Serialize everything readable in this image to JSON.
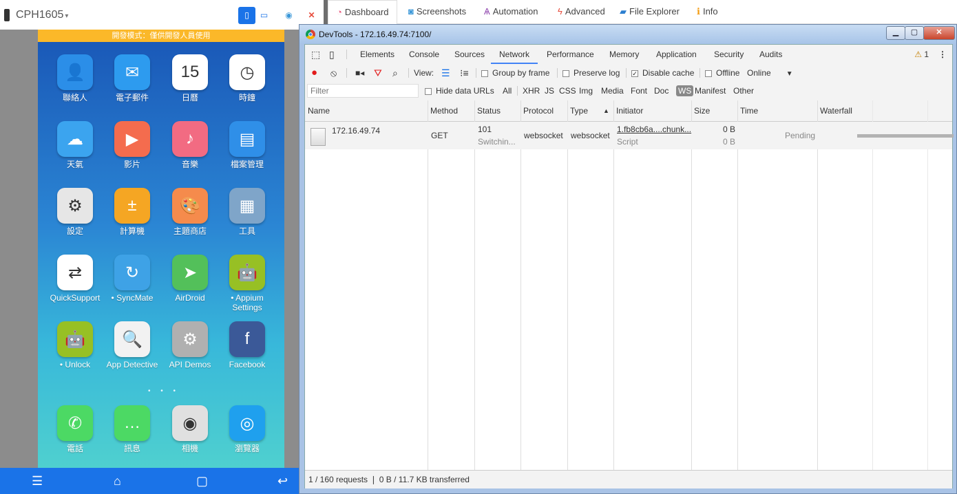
{
  "device": {
    "name": "CPH1605",
    "banner": "開發模式：僅供開發人員使用",
    "apps": [
      {
        "label": "聯絡人",
        "icon": "contacts-icon",
        "color": "#2b8ee8",
        "glyph": "👤"
      },
      {
        "label": "電子郵件",
        "icon": "mail-icon",
        "color": "#2d9bef",
        "glyph": "✉"
      },
      {
        "label": "日曆",
        "icon": "calendar-icon",
        "color": "#ffffff",
        "glyph": "15"
      },
      {
        "label": "時鐘",
        "icon": "clock-icon",
        "color": "#ffffff",
        "glyph": "◷"
      },
      {
        "label": "天氣",
        "icon": "weather-icon",
        "color": "#3ba4ef",
        "glyph": "☁"
      },
      {
        "label": "影片",
        "icon": "video-icon",
        "color": "#f46c4e",
        "glyph": "▶"
      },
      {
        "label": "音樂",
        "icon": "music-icon",
        "color": "#f26b82",
        "glyph": "♪"
      },
      {
        "label": "檔案管理",
        "icon": "file-manager-icon",
        "color": "#2f8fe8",
        "glyph": "▤"
      },
      {
        "label": "設定",
        "icon": "settings-icon",
        "color": "#e6e6e6",
        "glyph": "⚙"
      },
      {
        "label": "計算機",
        "icon": "calculator-icon",
        "color": "#f5a623",
        "glyph": "±"
      },
      {
        "label": "主題商店",
        "icon": "theme-store-icon",
        "color": "#f58b4c",
        "glyph": "🎨"
      },
      {
        "label": "工具",
        "icon": "tools-folder-icon",
        "color": "#7fa5c9",
        "glyph": "▦"
      },
      {
        "label": "QuickSupport",
        "icon": "quicksupport-icon",
        "color": "#ffffff",
        "glyph": "⇄"
      },
      {
        "label": "• SyncMate",
        "icon": "syncmate-icon",
        "color": "#3ea2e6",
        "glyph": "↻"
      },
      {
        "label": "AirDroid",
        "icon": "airdroid-icon",
        "color": "#53c05a",
        "glyph": "➤"
      },
      {
        "label": "• Appium Settings",
        "icon": "appium-android-icon",
        "color": "#97c024",
        "glyph": "🤖"
      },
      {
        "label": "• Unlock",
        "icon": "unlock-android-icon",
        "color": "#97c024",
        "glyph": "🤖"
      },
      {
        "label": "App Detective",
        "icon": "app-detective-icon",
        "color": "#f2f2f2",
        "glyph": "🔍"
      },
      {
        "label": "API Demos",
        "icon": "api-demos-folder-icon",
        "color": "#b0b0b0",
        "glyph": "⚙"
      },
      {
        "label": "Facebook",
        "icon": "facebook-icon",
        "color": "#3b5998",
        "glyph": "f"
      }
    ],
    "dock": [
      {
        "label": "電話",
        "icon": "phone-icon",
        "color": "#4cd964",
        "glyph": "✆"
      },
      {
        "label": "訊息",
        "icon": "messages-icon",
        "color": "#4cd964",
        "glyph": "…"
      },
      {
        "label": "相機",
        "icon": "camera-icon",
        "color": "#e0e0e0",
        "glyph": "◉"
      },
      {
        "label": "瀏覽器",
        "icon": "browser-icon",
        "color": "#1fa0ee",
        "glyph": "◎"
      }
    ]
  },
  "tabs": [
    {
      "label": "Dashboard",
      "icon": "dashboard-icon",
      "glyph": "◔",
      "color": "#e8557b"
    },
    {
      "label": "Screenshots",
      "icon": "camera-icon",
      "glyph": "◙",
      "color": "#3a97d8"
    },
    {
      "label": "Automation",
      "icon": "automation-icon",
      "glyph": "Ѧ",
      "color": "#8e44ad"
    },
    {
      "label": "Advanced",
      "icon": "bolt-icon",
      "glyph": "ϟ",
      "color": "#e74c3c"
    },
    {
      "label": "File Explorer",
      "icon": "folder-icon",
      "glyph": "▰",
      "color": "#2c7fd0"
    },
    {
      "label": "Info",
      "icon": "info-icon",
      "glyph": "ℹ",
      "color": "#f39c12"
    }
  ],
  "devtools": {
    "title": "DevTools - 172.16.49.74:7100/",
    "panels": [
      "Elements",
      "Console",
      "Sources",
      "Network",
      "Performance",
      "Memory",
      "Application",
      "Security",
      "Audits"
    ],
    "warning_count": "1",
    "toolbar": {
      "view_label": "View:",
      "group_by_frame": "Group by frame",
      "preserve_log": "Preserve log",
      "disable_cache": "Disable cache",
      "offline": "Offline",
      "throttle": "Online"
    },
    "filter_placeholder": "Filter",
    "hide_data_urls": "Hide data URLs",
    "type_filters": [
      "All",
      "XHR",
      "JS",
      "CSS",
      "Img",
      "Media",
      "Font",
      "Doc",
      "WS",
      "Manifest",
      "Other"
    ],
    "active_type_filter": "WS",
    "columns": [
      "Name",
      "Method",
      "Status",
      "Protocol",
      "Type",
      "Initiator",
      "Size",
      "Time",
      "Waterfall"
    ],
    "rows": [
      {
        "name": "172.16.49.74",
        "method": "GET",
        "status": "101",
        "status_text": "Switchin...",
        "protocol": "websocket",
        "type": "websocket",
        "initiator": "1.fb8cb6a....chunk...",
        "initiator_type": "Script",
        "size": "0 B",
        "size2": "0 B",
        "time": "Pending"
      }
    ],
    "status": "1 / 160 requests  ❘  0 B / 11.7 KB transferred"
  }
}
